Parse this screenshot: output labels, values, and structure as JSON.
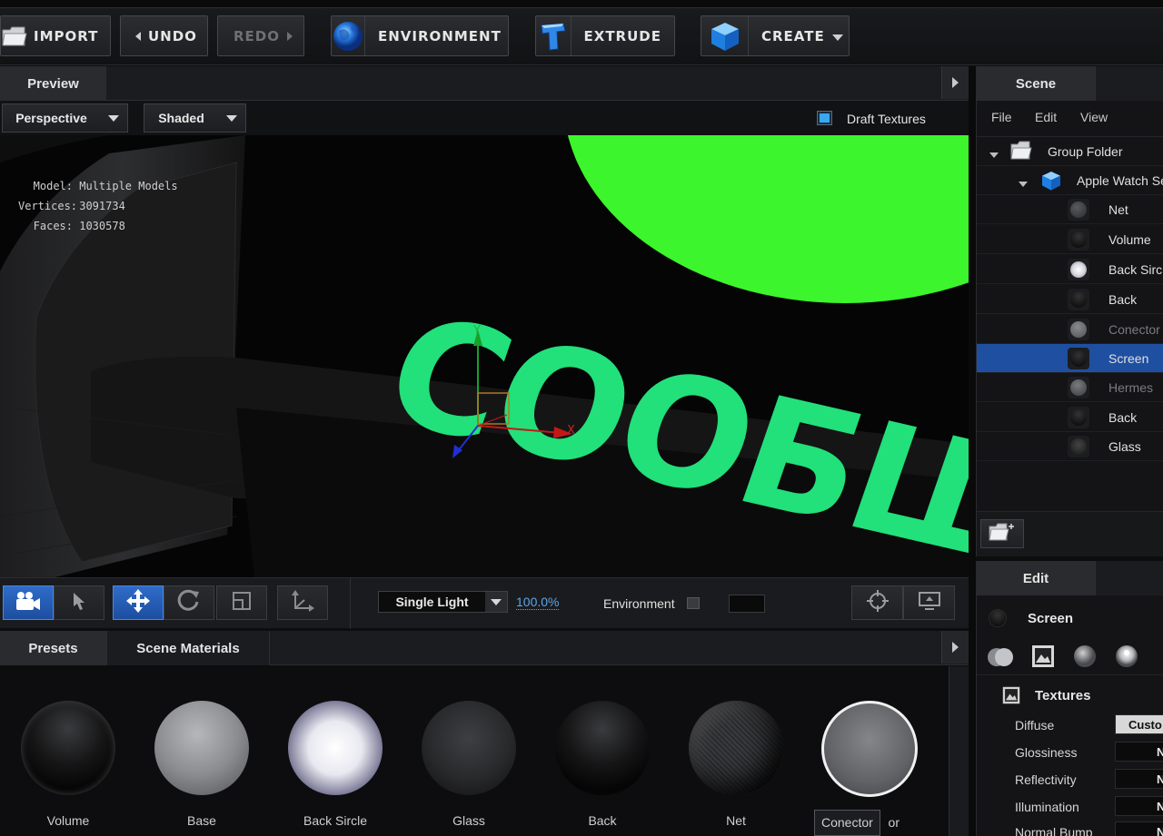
{
  "toolbar": {
    "import": "IMPORT",
    "undo": "UNDO",
    "redo": "REDO",
    "environment": "ENVIRONMENT",
    "extrude": "EXTRUDE",
    "create": "CREATE"
  },
  "preview": {
    "tab": "Preview",
    "view_mode": "Perspective",
    "shading": "Shaded",
    "draft_textures": "Draft Textures",
    "stats": {
      "model_label": "Model:",
      "model_value": "Multiple Models",
      "vertices_label": "Vertices:",
      "vertices_value": "3091734",
      "faces_label": "Faces:",
      "faces_value": "1030578"
    },
    "scene_text": "СООБЩ",
    "axis_x": "X",
    "axis_y": "Y"
  },
  "viewport_toolbar": {
    "light": "Single Light",
    "zoom": "100.0%",
    "environment": "Environment"
  },
  "materials": {
    "tabs": [
      "Presets",
      "Scene Materials"
    ],
    "items": [
      {
        "name": "Volume"
      },
      {
        "name": "Base"
      },
      {
        "name": "Back Sircle"
      },
      {
        "name": "Glass"
      },
      {
        "name": "Back"
      },
      {
        "name": "Net"
      },
      {
        "name": "or"
      }
    ],
    "tooltip": "Conector"
  },
  "scene": {
    "tab": "Scene",
    "menu": [
      "File",
      "Edit",
      "View"
    ],
    "tree": [
      {
        "label": "Group Folder",
        "type": "folder"
      },
      {
        "label": "Apple Watch Se",
        "type": "object"
      },
      {
        "label": "Net",
        "type": "material",
        "dim": false,
        "selected": false
      },
      {
        "label": "Volume",
        "type": "material",
        "dim": false,
        "selected": false
      },
      {
        "label": "Back Sircl",
        "type": "material",
        "dim": false,
        "selected": false
      },
      {
        "label": "Back",
        "type": "material",
        "dim": false,
        "selected": false
      },
      {
        "label": "Conector",
        "type": "material",
        "dim": true,
        "selected": false
      },
      {
        "label": "Screen",
        "type": "material",
        "dim": false,
        "selected": true
      },
      {
        "label": "Hermes",
        "type": "material",
        "dim": true,
        "selected": false
      },
      {
        "label": "Back",
        "type": "material",
        "dim": false,
        "selected": false
      },
      {
        "label": "Glass",
        "type": "material",
        "dim": false,
        "selected": false
      }
    ]
  },
  "edit": {
    "tab": "Edit",
    "material_name": "Screen",
    "section": "Textures",
    "properties": [
      {
        "label": "Diffuse",
        "value": "Custo"
      },
      {
        "label": "Glossiness",
        "value": "No"
      },
      {
        "label": "Reflectivity",
        "value": "No"
      },
      {
        "label": "Illumination",
        "value": "No"
      },
      {
        "label": "Normal Bump",
        "value": "No"
      }
    ]
  },
  "colors": {
    "accent_blue": "#1f4fa0",
    "screen_green": "#22e07a",
    "disc_green": "#3cf52c"
  }
}
